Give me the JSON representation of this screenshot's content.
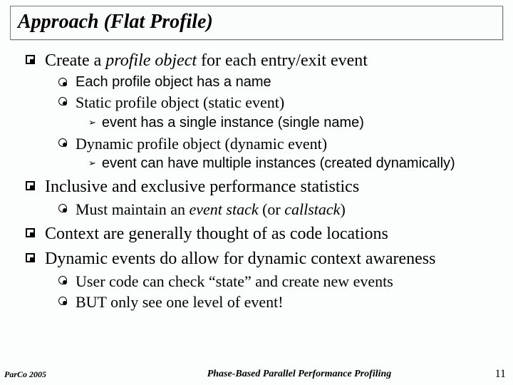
{
  "title": "Approach (Flat Profile)",
  "items": [
    {
      "level": 1,
      "segments": [
        {
          "t": "Create a "
        },
        {
          "t": "profile object",
          "i": true
        },
        {
          "t": " for each entry/exit event"
        }
      ]
    },
    {
      "level": 2,
      "arial": true,
      "segments": [
        {
          "t": "Each profile object has a name"
        }
      ]
    },
    {
      "level": 2,
      "segments": [
        {
          "t": "Static profile object (static event)"
        }
      ]
    },
    {
      "level": 3,
      "segments": [
        {
          "t": "event has a single instance (single name)"
        }
      ]
    },
    {
      "level": 2,
      "segments": [
        {
          "t": "Dynamic profile object (dynamic event)"
        }
      ]
    },
    {
      "level": 3,
      "segments": [
        {
          "t": "event can have multiple instances (created dynamically)"
        }
      ]
    },
    {
      "level": 1,
      "segments": [
        {
          "t": "Inclusive and exclusive performance statistics"
        }
      ]
    },
    {
      "level": 2,
      "segments": [
        {
          "t": "Must maintain an "
        },
        {
          "t": "event stack",
          "i": true
        },
        {
          "t": " (or "
        },
        {
          "t": "callstack",
          "i": true
        },
        {
          "t": ")"
        }
      ]
    },
    {
      "level": 1,
      "segments": [
        {
          "t": "Context are generally thought of as code locations"
        }
      ]
    },
    {
      "level": 1,
      "segments": [
        {
          "t": "Dynamic events do allow for dynamic context awareness"
        }
      ]
    },
    {
      "level": 2,
      "segments": [
        {
          "t": "User code can check “state” and create new events"
        }
      ]
    },
    {
      "level": 2,
      "segments": [
        {
          "t": "BUT only see one level of event!"
        }
      ]
    }
  ],
  "footer": {
    "left": "ParCo 2005",
    "center": "Phase-Based Parallel Performance Profiling",
    "right": "11"
  },
  "bullets": {
    "lvl3": "➢"
  }
}
